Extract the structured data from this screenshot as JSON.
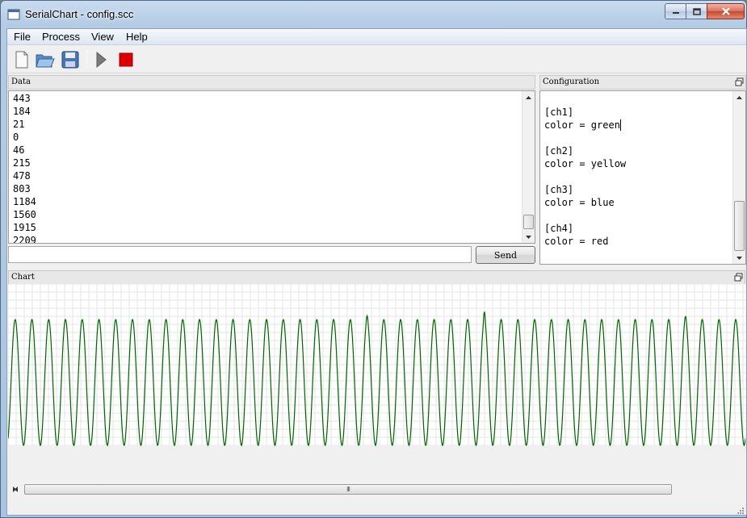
{
  "window": {
    "title": "SerialChart - config.scc"
  },
  "menu": [
    "File",
    "Process",
    "View",
    "Help"
  ],
  "toolbar": {
    "icons": [
      "new-file-icon",
      "open-folder-icon",
      "save-disk-icon",
      "play-icon",
      "stop-icon"
    ]
  },
  "data_panel": {
    "title": "Data",
    "lines": [
      "443",
      "184",
      "21",
      "0",
      "46",
      "215",
      "478",
      "803",
      "1184",
      "1560",
      "1915",
      "2209"
    ],
    "send_input": {
      "value": ""
    },
    "send_label": "Send"
  },
  "config_panel": {
    "title": "Configuration",
    "lines": [
      "[ch1]",
      "color = green",
      "",
      "[ch2]",
      "color = yellow",
      "",
      "[ch3]",
      "color = blue",
      "",
      "[ch4]",
      "color = red"
    ]
  },
  "chart_panel": {
    "title": "Chart",
    "series_color": "#006400",
    "hscroll_grip": "III"
  },
  "chart_data": {
    "type": "line",
    "title": "",
    "xlabel": "",
    "ylabel": "",
    "grid": true,
    "series": [
      {
        "color": "#006400",
        "shape": "sine",
        "cycles": 44,
        "amplitude": 1.0,
        "peak_spikes": [
          {
            "cycle": 21,
            "extra": 0.06
          },
          {
            "cycle": 28,
            "extra": 0.12
          },
          {
            "cycle": 40,
            "extra": 0.05
          }
        ]
      }
    ]
  },
  "colors": {
    "accent_stop": "#dd0000",
    "play_gray": "#7a7a7a"
  }
}
